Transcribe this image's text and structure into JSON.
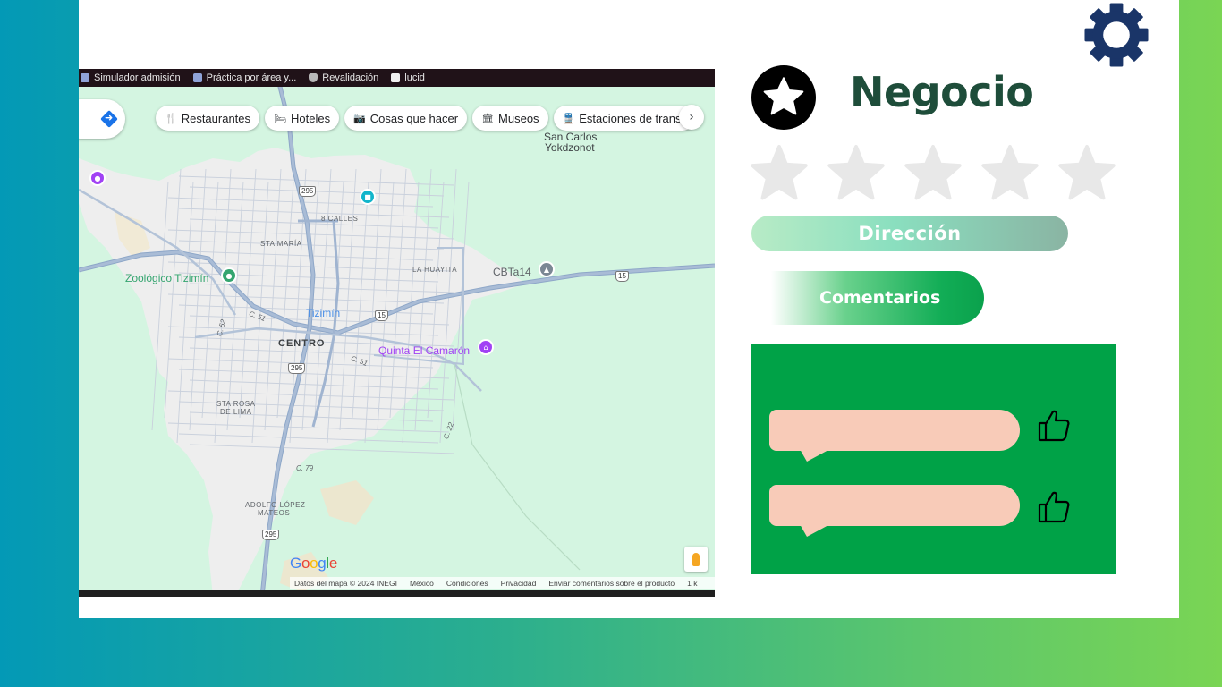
{
  "bookmarks": [
    {
      "label": "Simulador admisión",
      "icon": "bookmark-icon"
    },
    {
      "label": "Práctica por área y...",
      "icon": "bookmark-icon"
    },
    {
      "label": "Revalidación",
      "icon": "shield-icon"
    },
    {
      "label": "lucid",
      "icon": "lucid-icon"
    }
  ],
  "map": {
    "chips": [
      {
        "label": "Restaurantes",
        "icon": "fork-knife-icon"
      },
      {
        "label": "Hoteles",
        "icon": "bed-icon"
      },
      {
        "label": "Cosas que hacer",
        "icon": "camera-icon"
      },
      {
        "label": "Museos",
        "icon": "museum-icon"
      },
      {
        "label": "Estaciones de transp",
        "icon": "train-icon"
      }
    ],
    "labels": {
      "san_carlos_1": "San Carlos",
      "san_carlos_2": "Yokdzonot",
      "ocho_calles": "8 CALLES",
      "sta_maria": "STA MARÍA",
      "la_huayita": "LA HUAYITA",
      "cbta": "CBTa14",
      "zoologico": "Zoológico Tizimín",
      "tizimin": "Tizimín",
      "centro": "CENTRO",
      "quinta": "Quinta El Camarón",
      "sta_rosa_1": "STA ROSA",
      "sta_rosa_2": "DE LIMA",
      "adolfo_1": "ADOLFO LÓPEZ",
      "adolfo_2": "MATEOS",
      "c51a": "C. 51",
      "c51b": "C. 51",
      "c52": "C. 52",
      "c22": "C. 22",
      "c79": "C. 79"
    },
    "shields": {
      "s295a": "295",
      "s295b": "295",
      "s295c": "295",
      "s15a": "15",
      "s15b": "15"
    },
    "footer": {
      "data": "Datos del mapa © 2024 INEGI",
      "region": "México",
      "terms": "Condiciones",
      "privacy": "Privacidad",
      "feedback": "Enviar comentarios sobre el producto",
      "scale": "1 k"
    },
    "logo": "Google"
  },
  "business": {
    "title": "Negocio",
    "rating": 0,
    "max_rating": 5,
    "address_label": "Dirección",
    "comments_label": "Comentarios"
  },
  "colors": {
    "title": "#1e4d3a",
    "gear": "#1a3568",
    "star_empty": "#e8e8e8",
    "comments_bg": "#00a247",
    "bubble": "#f8cbb8"
  }
}
